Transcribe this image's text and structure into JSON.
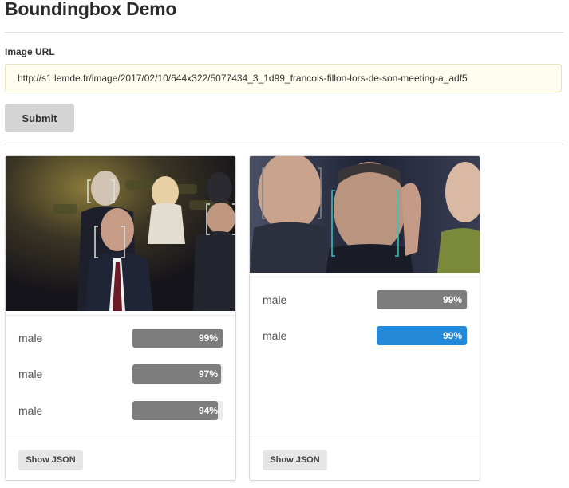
{
  "page": {
    "title": "Boundingbox Demo",
    "image_url_label": "Image URL",
    "image_url_value": "http://s1.lemde.fr/image/2017/02/10/644x322/5077434_3_1d99_francois-fillon-lors-de-son-meeting-a_adf5",
    "submit_label": "Submit"
  },
  "cards": [
    {
      "faces": [
        {
          "label": "male",
          "confidence": 0.99,
          "text": "99%",
          "color": "#7d7d7d"
        },
        {
          "label": "male",
          "confidence": 0.97,
          "text": "97%",
          "color": "#7d7d7d"
        },
        {
          "label": "male",
          "confidence": 0.94,
          "text": "94%",
          "color": "#7d7d7d"
        }
      ],
      "show_json_label": "Show JSON",
      "box_color": "#e0e0e0"
    },
    {
      "faces": [
        {
          "label": "male",
          "confidence": 0.99,
          "text": "99%",
          "color": "#7d7d7d"
        },
        {
          "label": "male",
          "confidence": 0.99,
          "text": "99%",
          "color": "#2389d8"
        }
      ],
      "show_json_label": "Show JSON",
      "box_color": "#36c7c0"
    }
  ]
}
